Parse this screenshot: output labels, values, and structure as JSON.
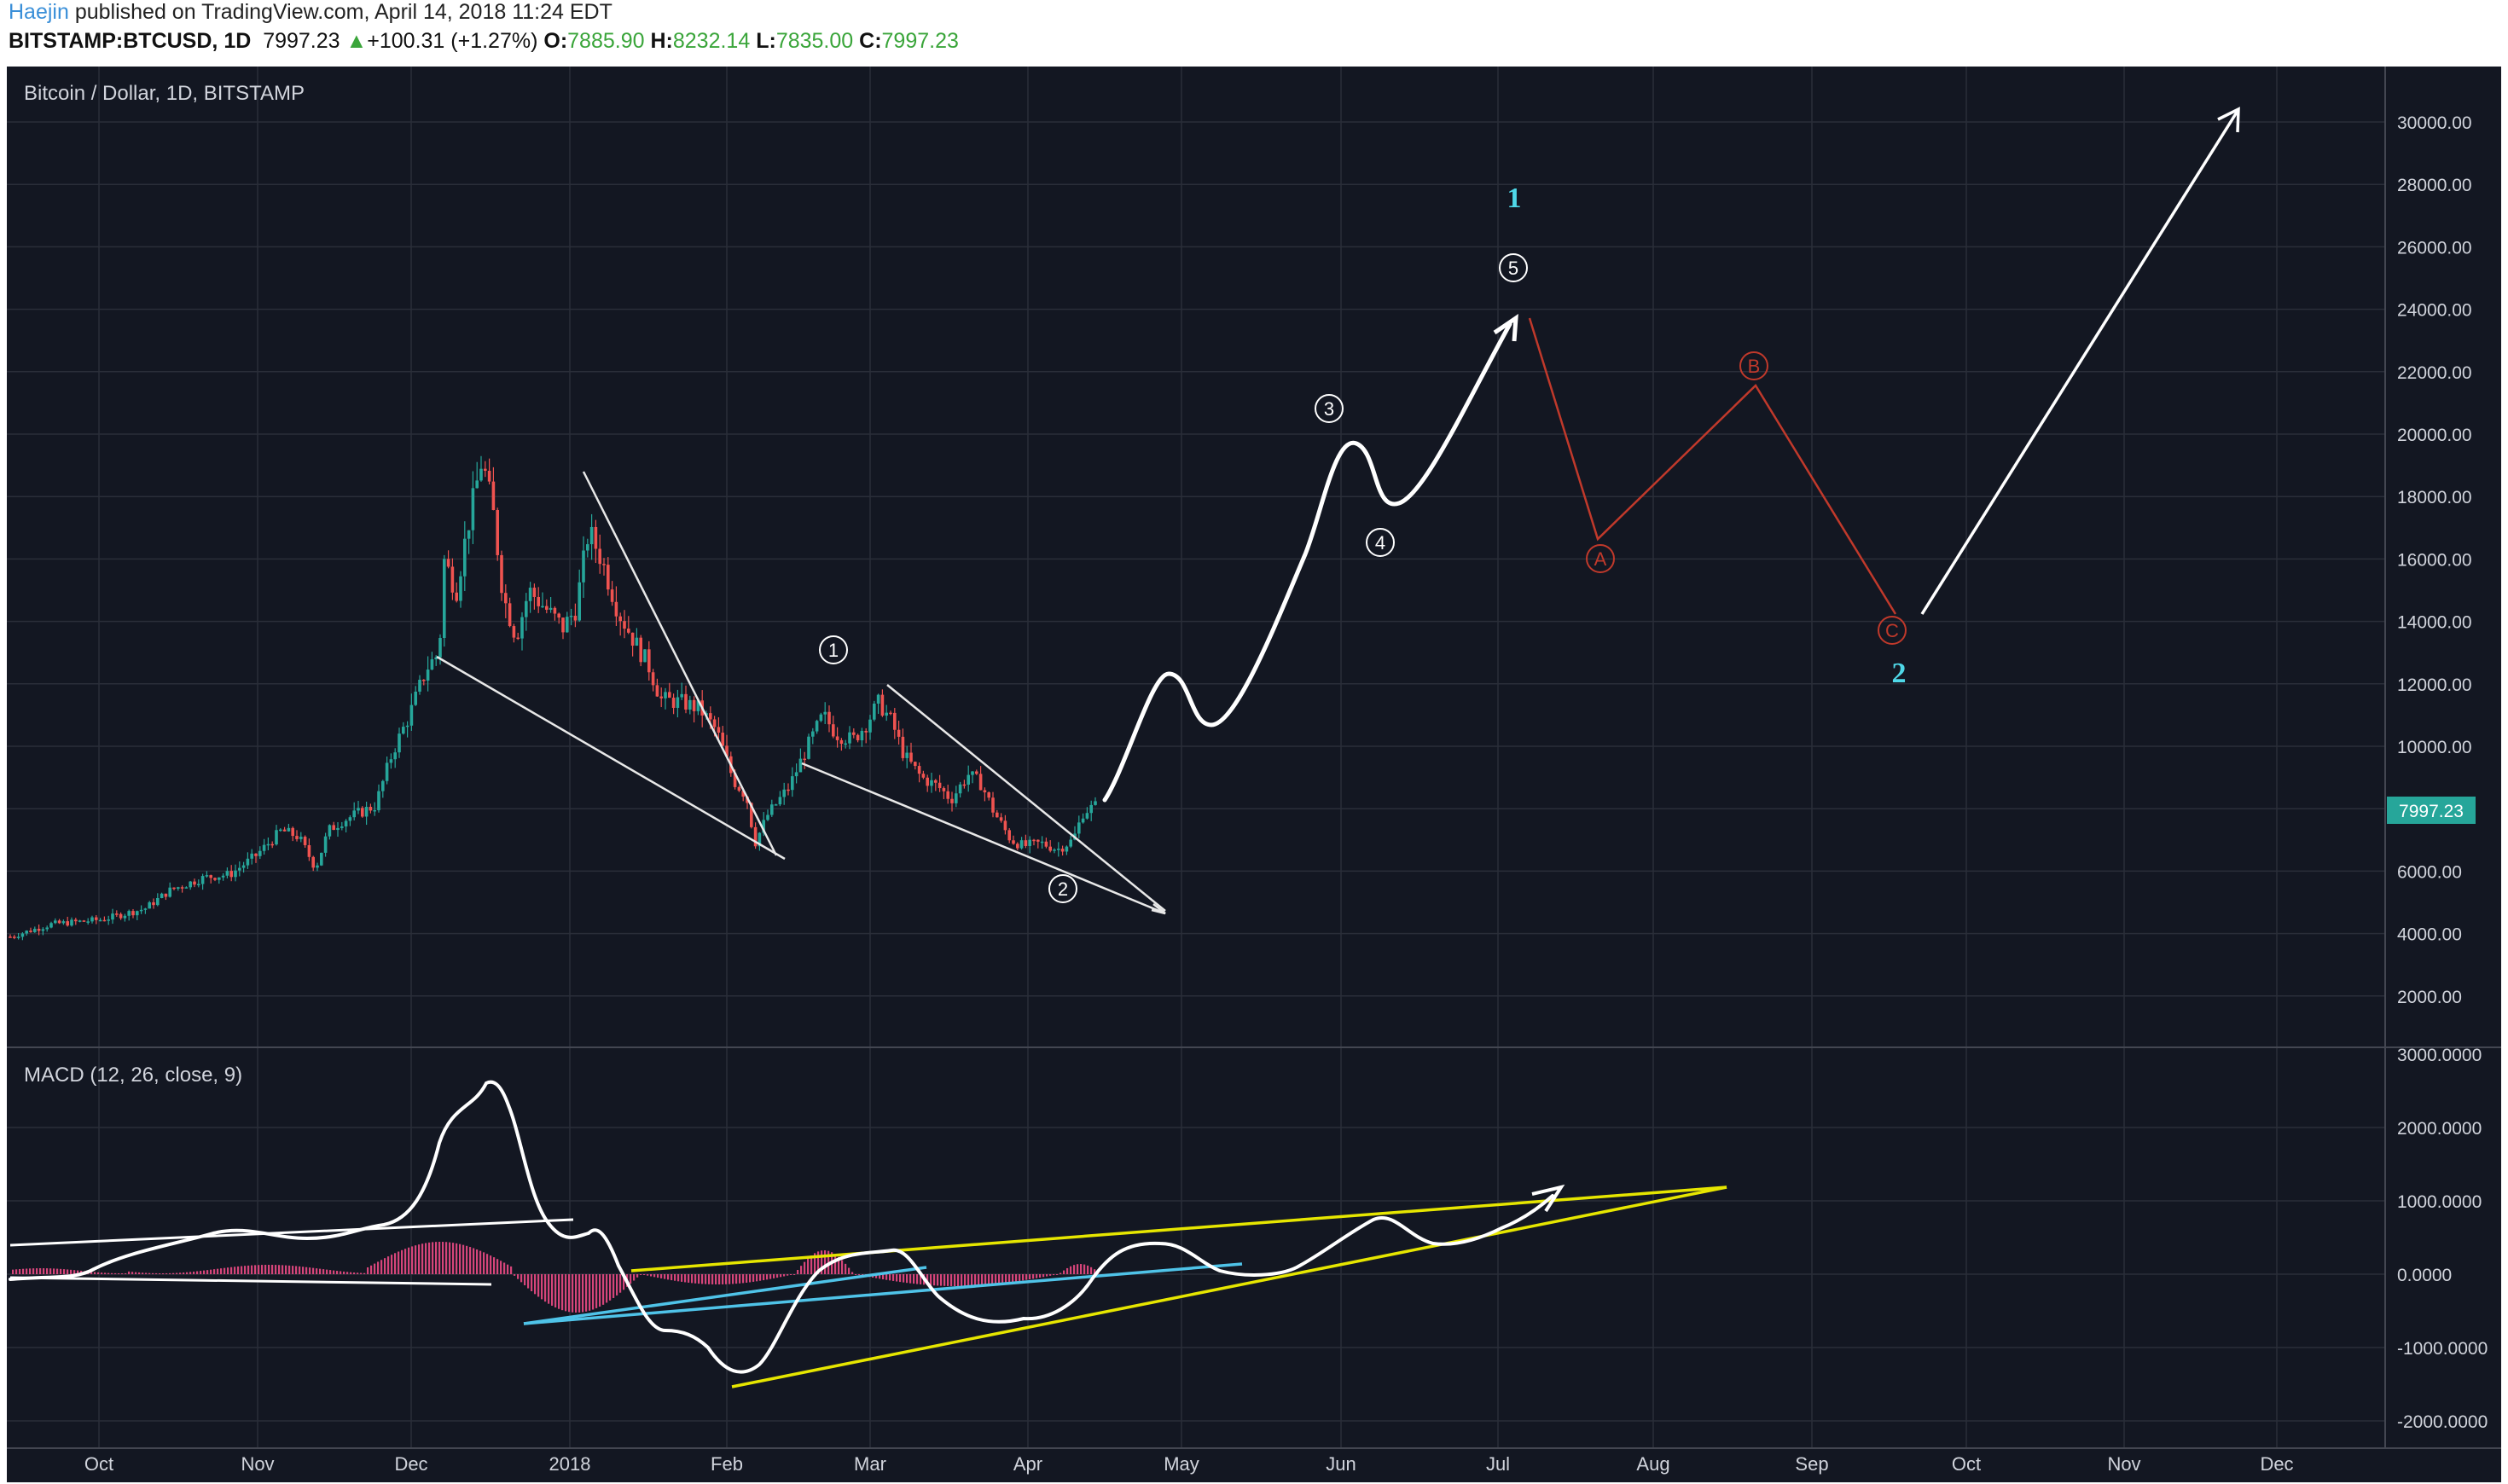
{
  "header": {
    "author": "Haejin",
    "published": "published on TradingView.com, April 14, 2018 11:24 EDT",
    "symbol": "BITSTAMP:BTCUSD",
    "interval": "1D",
    "last": "7997.23",
    "change": "+100.31 (+1.27%)",
    "o_label": "O:",
    "o": "7885.90",
    "h_label": "H:",
    "h": "8232.14",
    "l_label": "L:",
    "l": "7835.00",
    "c_label": "C:",
    "c": "7997.23"
  },
  "main_pane": {
    "title": "Bitcoin / Dollar, 1D, BITSTAMP",
    "price_labels": [
      "30000.00",
      "28000.00",
      "26000.00",
      "24000.00",
      "22000.00",
      "20000.00",
      "18000.00",
      "16000.00",
      "14000.00",
      "12000.00",
      "10000.00",
      "8000.00",
      "6000.00",
      "4000.00",
      "2000.00"
    ],
    "last_price_tag": "7997.23"
  },
  "macd_pane": {
    "title": "MACD (12, 26, close, 9)",
    "labels": [
      "3000.0000",
      "2000.0000",
      "1000.0000",
      "0.0000",
      "-1000.0000",
      "-2000.0000"
    ]
  },
  "time_axis": [
    "Oct",
    "Nov",
    "Dec",
    "2018",
    "Feb",
    "Mar",
    "Apr",
    "May",
    "Jun",
    "Jul",
    "Aug",
    "Sep",
    "Oct",
    "Nov",
    "Dec"
  ],
  "wave_labels": {
    "w1": "1",
    "w2": "2",
    "w3": "3",
    "w4": "4",
    "w5": "5",
    "A": "A",
    "B": "B",
    "C": "C",
    "big1": "1",
    "big2": "2"
  },
  "colors": {
    "background": "#131722",
    "grid": "#2a2e39",
    "up": "#26a69a",
    "down": "#ef5350",
    "correction": "#c0392b",
    "yellow": "#e6e600",
    "cyan": "#4fc3e8",
    "histogram": "#d6457a"
  }
}
